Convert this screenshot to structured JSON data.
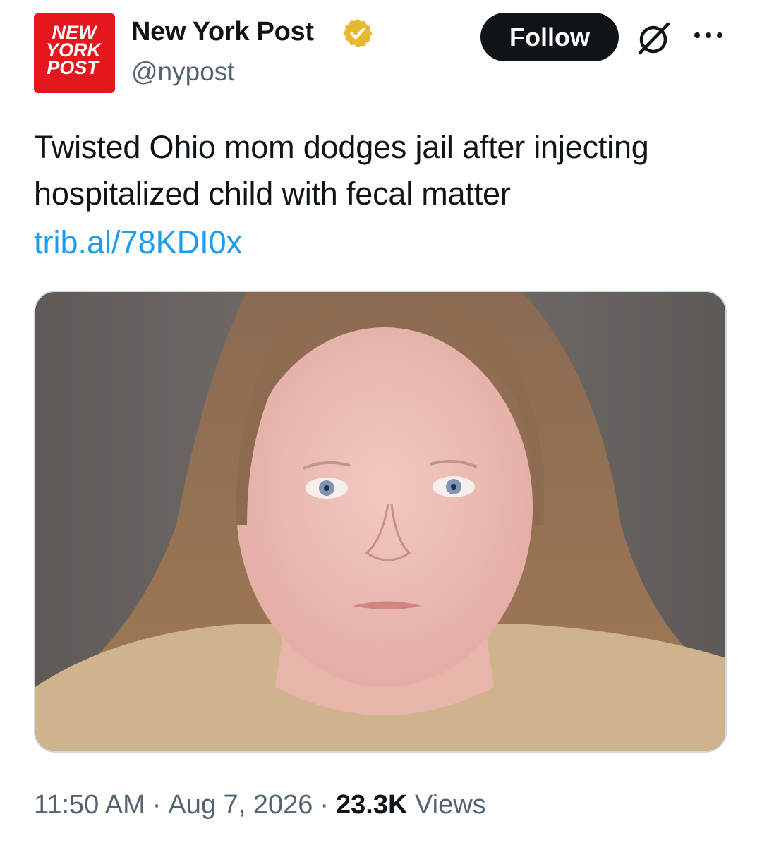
{
  "author": {
    "display_name": "New York Post",
    "handle": "@nypost",
    "verified": true,
    "avatar_logo_text": [
      "NEW",
      "YORK",
      "POST"
    ],
    "avatar_color": "#e3171d",
    "verified_badge_color": "#e8b830"
  },
  "header": {
    "follow_label": "Follow",
    "grok_icon": "grok-icon",
    "more_icon": "more-dots-icon"
  },
  "tweet": {
    "text": "Twisted Ohio mom dodges jail after injecting hospitalized child with fecal matter",
    "link": "trib.al/78KDI0x",
    "link_color": "#1d9bf0"
  },
  "meta": {
    "time": "11:50 AM",
    "date": "Aug 7, 2026",
    "separator": "·",
    "views_count": "23.3K",
    "views_label": "Views"
  },
  "colors": {
    "text": "#0f1419",
    "secondary": "#536471",
    "follow_bg": "#0f1419",
    "media_border": "#cfd9de"
  }
}
